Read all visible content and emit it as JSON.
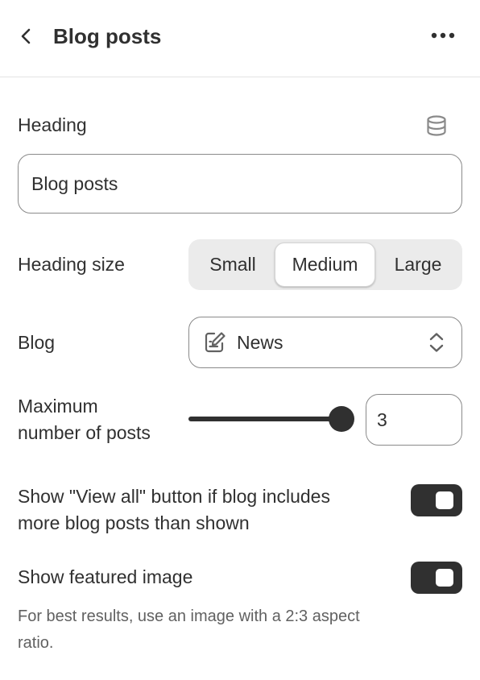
{
  "header": {
    "title": "Blog posts"
  },
  "heading_field": {
    "label": "Heading",
    "value": "Blog posts"
  },
  "heading_size": {
    "label": "Heading size",
    "options": [
      "Small",
      "Medium",
      "Large"
    ],
    "selected": "Medium"
  },
  "blog": {
    "label": "Blog",
    "value": "News"
  },
  "max_posts": {
    "label_line1": "Maximum",
    "label_line2": "number of posts",
    "value": "3",
    "slider_fraction": 1
  },
  "view_all_toggle": {
    "label_line1": "Show \"View all\" button if blog includes",
    "label_line2": "more blog posts than shown",
    "on": true
  },
  "featured_image_toggle": {
    "label": "Show featured image",
    "on": true,
    "help_line1": "For best results, use an image with a 2:3 aspect",
    "help_line2": "ratio."
  },
  "icons": {
    "back": "chevron-left-icon",
    "more": "more-horizontal-icon",
    "dynamic_source": "database-icon",
    "blog": "blog-document-icon",
    "select": "chevron-up-down-icon"
  },
  "colors": {
    "text": "#303030",
    "muted": "#616161",
    "toggle_on": "#303030",
    "segment_bg": "#ebebeb",
    "border": "#8a8a8a"
  }
}
